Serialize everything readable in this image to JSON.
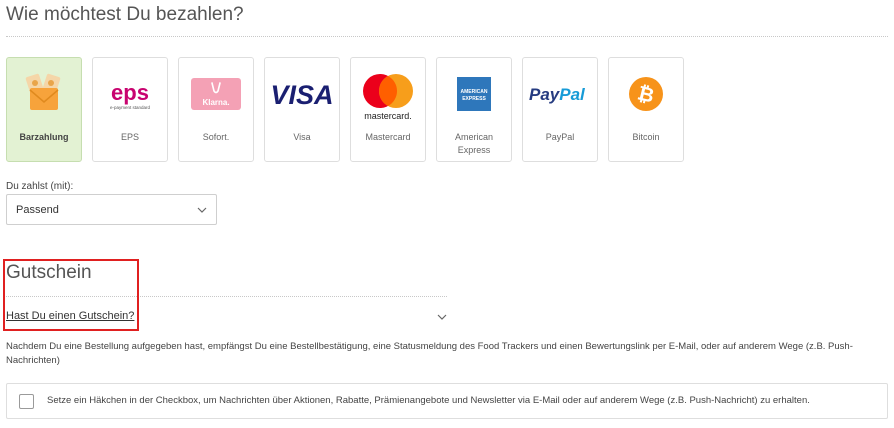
{
  "payment": {
    "title": "Wie möchtest Du bezahlen?",
    "methods": [
      {
        "label": "Barzahlung",
        "icon": "cash-envelope-icon",
        "selected": true
      },
      {
        "label": "EPS",
        "icon": "eps-logo",
        "logo_text": "eps",
        "logo_subtext": "e-payment standard"
      },
      {
        "label": "Sofort.",
        "icon": "klarna-logo",
        "logo_text": "Klarna."
      },
      {
        "label": "Visa",
        "icon": "visa-logo",
        "logo_text": "VISA"
      },
      {
        "label": "Mastercard",
        "icon": "mastercard-logo",
        "logo_text": "mastercard."
      },
      {
        "label": "American Express",
        "icon": "amex-logo",
        "logo_text": "AMERICAN EXPRESS"
      },
      {
        "label": "PayPal",
        "icon": "paypal-logo",
        "logo_text": "PayPal"
      },
      {
        "label": "Bitcoin",
        "icon": "bitcoin-logo"
      }
    ],
    "pay_with_label": "Du zahlst (mit):",
    "pay_with_value": "Passend"
  },
  "voucher": {
    "title": "Gutschein",
    "link": "Hast Du einen Gutschein?"
  },
  "notice": "Nachdem Du eine Bestellung aufgegeben hast, empfängst Du eine Bestellbestätigung, eine Statusmeldung des Food Trackers und einen Bewertungslink per E-Mail, oder auf anderem Wege (z.B. Push-Nachrichten)",
  "consent": {
    "text": "Setze ein Häkchen in der Checkbox, um Nachrichten über Aktionen, Rabatte, Prämienangebote und Newsletter via E-Mail oder auf anderem Wege (z.B. Push-Nachricht) zu erhalten.",
    "checked": false
  },
  "colors": {
    "selected_bg": "#e3f2d3",
    "highlight_border": "#e02020",
    "visa_blue": "#1a1f71",
    "mastercard_red": "#eb001b",
    "mastercard_orange": "#f79e1b",
    "paypal_dark": "#253b80",
    "paypal_light": "#179bd7",
    "bitcoin_orange": "#f7931a",
    "eps_magenta": "#c8036f",
    "klarna_pink": "#f4a1b5"
  }
}
